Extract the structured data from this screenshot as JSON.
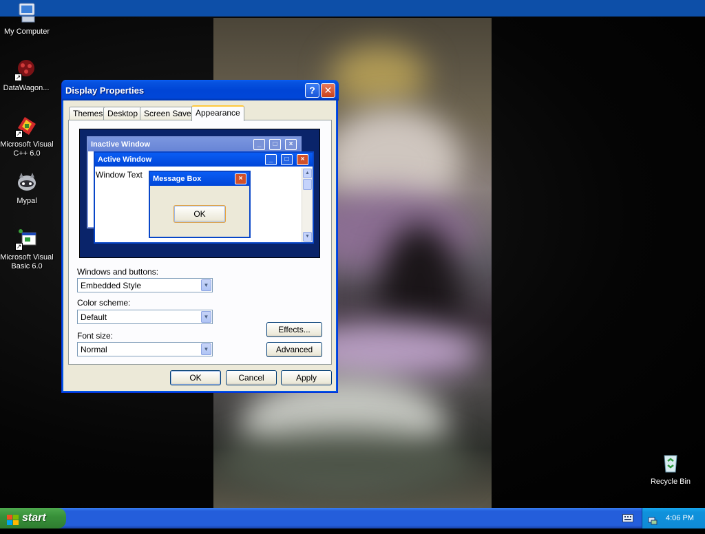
{
  "desktop": {
    "icons": [
      {
        "label": "My Computer",
        "icon": "computer-icon"
      },
      {
        "label": "DataWagon...",
        "icon": "datawagon-icon"
      },
      {
        "label": "Microsoft Visual C++ 6.0",
        "icon": "visual-cpp-icon"
      },
      {
        "label": "Mypal",
        "icon": "mypal-icon"
      },
      {
        "label": "Microsoft Visual Basic 6.0",
        "icon": "visual-basic-icon"
      },
      {
        "label": "Recycle Bin",
        "icon": "recycle-bin-icon"
      }
    ]
  },
  "dialog": {
    "title": "Display Properties",
    "help_glyph": "?",
    "close_glyph": "✕",
    "tabs": [
      {
        "label": "Themes",
        "active": false
      },
      {
        "label": "Desktop",
        "active": false
      },
      {
        "label": "Screen Saver",
        "active": false
      },
      {
        "label": "Appearance",
        "active": true
      }
    ],
    "preview": {
      "inactive_title": "Inactive Window",
      "active_title": "Active Window",
      "window_text": "Window Text",
      "message_box_title": "Message Box",
      "message_ok": "OK"
    },
    "windows_buttons": {
      "label": "Windows and buttons:",
      "value": "Embedded Style"
    },
    "color_scheme": {
      "label": "Color scheme:",
      "value": "Default"
    },
    "font_size": {
      "label": "Font size:",
      "value": "Normal"
    },
    "effects_button": "Effects...",
    "advanced_button": "Advanced",
    "ok_button": "OK",
    "cancel_button": "Cancel",
    "apply_button": "Apply"
  },
  "taskbar": {
    "start_label": "start",
    "clock": "4:06 PM"
  },
  "colors": {
    "title_blue": "#0054e3",
    "taskbar_blue": "#245edb",
    "start_green": "#38913a",
    "dialog_face": "#ece9d8",
    "tab_highlight": "#ffc83c"
  }
}
